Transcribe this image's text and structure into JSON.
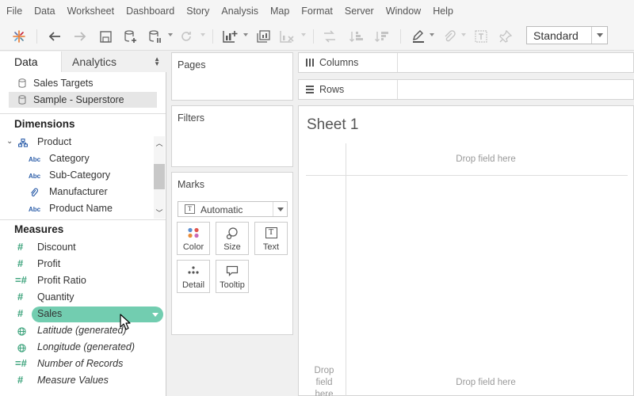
{
  "menu": [
    "File",
    "Data",
    "Worksheet",
    "Dashboard",
    "Story",
    "Analysis",
    "Map",
    "Format",
    "Server",
    "Window",
    "Help"
  ],
  "toolbar": {
    "icons": [
      "tableau-logo-icon",
      "back-icon",
      "forward-icon",
      "save-icon",
      "new-datasource-icon",
      "pause-updates-icon",
      "refresh-icon",
      "new-worksheet-icon",
      "duplicate-icon",
      "clear-icon",
      "swap-icon",
      "sort-ascending-icon",
      "sort-descending-icon",
      "highlight-icon",
      "attach-icon",
      "label-icon",
      "pin-icon"
    ],
    "fit_select": "Standard"
  },
  "data_pane": {
    "tabs": {
      "data": "Data",
      "analytics": "Analytics"
    },
    "datasources": [
      {
        "label": "Sales Targets",
        "selected": false
      },
      {
        "label": "Sample - Superstore",
        "selected": true
      }
    ],
    "dimensions_title": "Dimensions",
    "dimension_group": "Product",
    "dimensions": [
      {
        "label": "Category",
        "type": "Abc"
      },
      {
        "label": "Sub-Category",
        "type": "Abc"
      },
      {
        "label": "Manufacturer",
        "type": "clip"
      },
      {
        "label": "Product Name",
        "type": "Abc"
      }
    ],
    "measures_title": "Measures",
    "measures": [
      {
        "label": "Discount",
        "type": "number",
        "italic": false
      },
      {
        "label": "Profit",
        "type": "number",
        "italic": false
      },
      {
        "label": "Profit Ratio",
        "type": "calc",
        "italic": false
      },
      {
        "label": "Quantity",
        "type": "number",
        "italic": false
      },
      {
        "label": "Sales",
        "type": "number",
        "italic": false,
        "selected": true
      },
      {
        "label": "Latitude (generated)",
        "type": "globe",
        "italic": true
      },
      {
        "label": "Longitude (generated)",
        "type": "globe",
        "italic": true
      },
      {
        "label": "Number of Records",
        "type": "calc",
        "italic": true
      },
      {
        "label": "Measure Values",
        "type": "number",
        "italic": true
      }
    ]
  },
  "cards": {
    "pages": "Pages",
    "filters": "Filters",
    "marks": "Marks",
    "mark_type": "Automatic",
    "mark_type_icon_text": "T",
    "mark_buttons": [
      "Color",
      "Size",
      "Text",
      "Detail",
      "Tooltip"
    ],
    "mark_text_icon": "T"
  },
  "shelves": {
    "columns": "Columns",
    "rows": "Rows"
  },
  "sheet": {
    "title": "Sheet 1",
    "drop_top": "Drop field here",
    "drop_left": "Drop field here",
    "drop_bottom": "Drop field here"
  },
  "colors": {
    "pill": "#72cdb0",
    "measure_icon": "#3aa27a",
    "dimension_icon": "#2a5ca8"
  }
}
